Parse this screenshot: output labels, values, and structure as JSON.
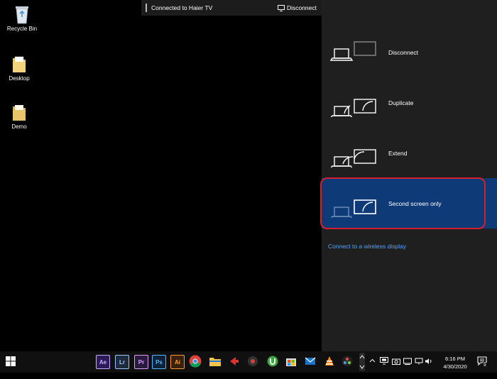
{
  "desktop": {
    "icons": [
      {
        "label": "Recycle Bin"
      },
      {
        "label": "Desktop"
      },
      {
        "label": "Demo"
      }
    ]
  },
  "cast_bar": {
    "title": "Connected to Haier TV",
    "disconnect_label": "Disconnect"
  },
  "project_panel": {
    "options": [
      {
        "label": "Disconnect"
      },
      {
        "label": "Duplicate"
      },
      {
        "label": "Extend"
      },
      {
        "label": "Second screen only",
        "selected": true
      }
    ],
    "wireless_link": "Connect to a wireless display"
  },
  "taskbar": {
    "apps": [
      {
        "name": "Ae",
        "color": "#2b1b5a",
        "fg": "#c8b0ff"
      },
      {
        "name": "Lr",
        "color": "#1d2b3c",
        "fg": "#9fc7ff"
      },
      {
        "name": "Pr",
        "color": "#2a1a3d",
        "fg": "#d9a0ff"
      },
      {
        "name": "Ps",
        "color": "#0b2238",
        "fg": "#54b8ff"
      },
      {
        "name": "Ai",
        "color": "#3a2009",
        "fg": "#ff9a2e"
      }
    ],
    "time": "6:16 PM",
    "date": "4/30/2020",
    "notification_count": "9"
  },
  "colors": {
    "panel_bg": "#1f1f1f",
    "selected_bg": "#0e3b78",
    "highlight_ring": "#d4202d",
    "link": "#4fa3ff"
  }
}
